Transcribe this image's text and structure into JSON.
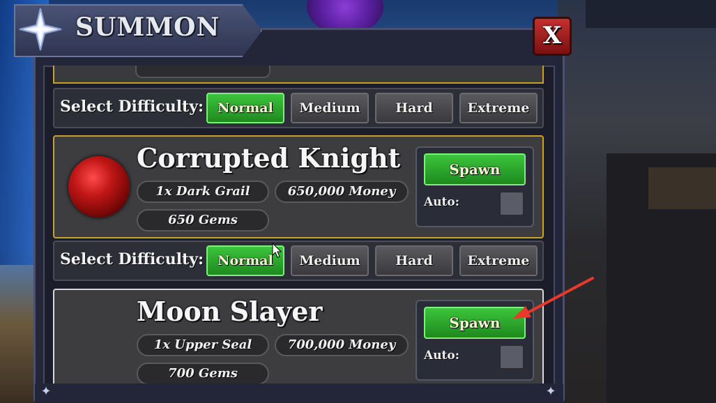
{
  "window": {
    "title": "SUMMON",
    "close_label": "X"
  },
  "difficulty_label": "Select Difficulty:",
  "difficulties": [
    "Normal",
    "Medium",
    "Hard",
    "Extreme"
  ],
  "bosses": [
    {
      "name": "Corrupted Knight",
      "item_cost": "1x Dark Grail",
      "money_cost": "650,000 Money",
      "gem_cost": "650 Gems",
      "spawn_label": "Spawn",
      "auto_label": "Auto:"
    },
    {
      "name": "Moon Slayer",
      "item_cost": "1x Upper Seal",
      "money_cost": "700,000 Money",
      "gem_cost": "700 Gems",
      "spawn_label": "Spawn",
      "auto_label": "Auto:"
    }
  ],
  "colors": {
    "selected_green": "#2fa82f",
    "unselected_gray": "#4a4a4e",
    "card_border_gold": "#c9a227",
    "close_red": "#b22222",
    "annotation_arrow": "#e8392b"
  },
  "icons": [
    "star-icon",
    "corrupted-orb-icon",
    "mouse-cursor-icon",
    "annotation-arrow-icon"
  ]
}
